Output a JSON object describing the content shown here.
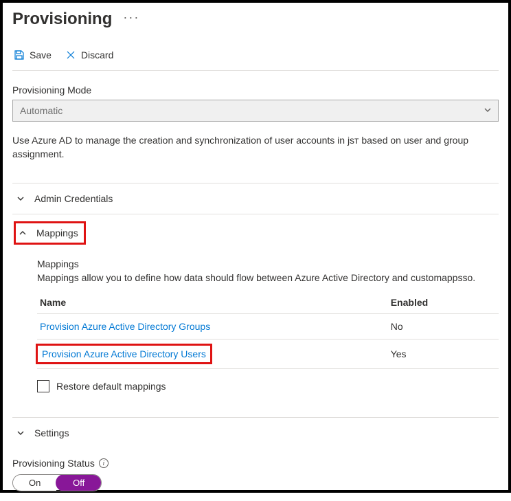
{
  "header": {
    "title": "Provisioning"
  },
  "toolbar": {
    "save_label": "Save",
    "discard_label": "Discard"
  },
  "mode": {
    "label": "Provisioning Mode",
    "value": "Automatic"
  },
  "description": "Use Azure AD to manage the creation and synchronization of user accounts in jsт based on user and group assignment.",
  "sections": {
    "admin": {
      "title": "Admin Credentials"
    },
    "mappings": {
      "title": "Mappings",
      "content_heading": "Mappings",
      "content_desc": "Mappings allow you to define how data should flow between Azure Active Directory and customappsso.",
      "col_name": "Name",
      "col_enabled": "Enabled",
      "rows": [
        {
          "name": "Provision Azure Active Directory Groups",
          "enabled": "No"
        },
        {
          "name": "Provision Azure Active Directory Users",
          "enabled": "Yes"
        }
      ],
      "restore_label": "Restore default mappings"
    },
    "settings": {
      "title": "Settings"
    }
  },
  "status": {
    "label": "Provisioning Status",
    "on_label": "On",
    "off_label": "Off"
  }
}
